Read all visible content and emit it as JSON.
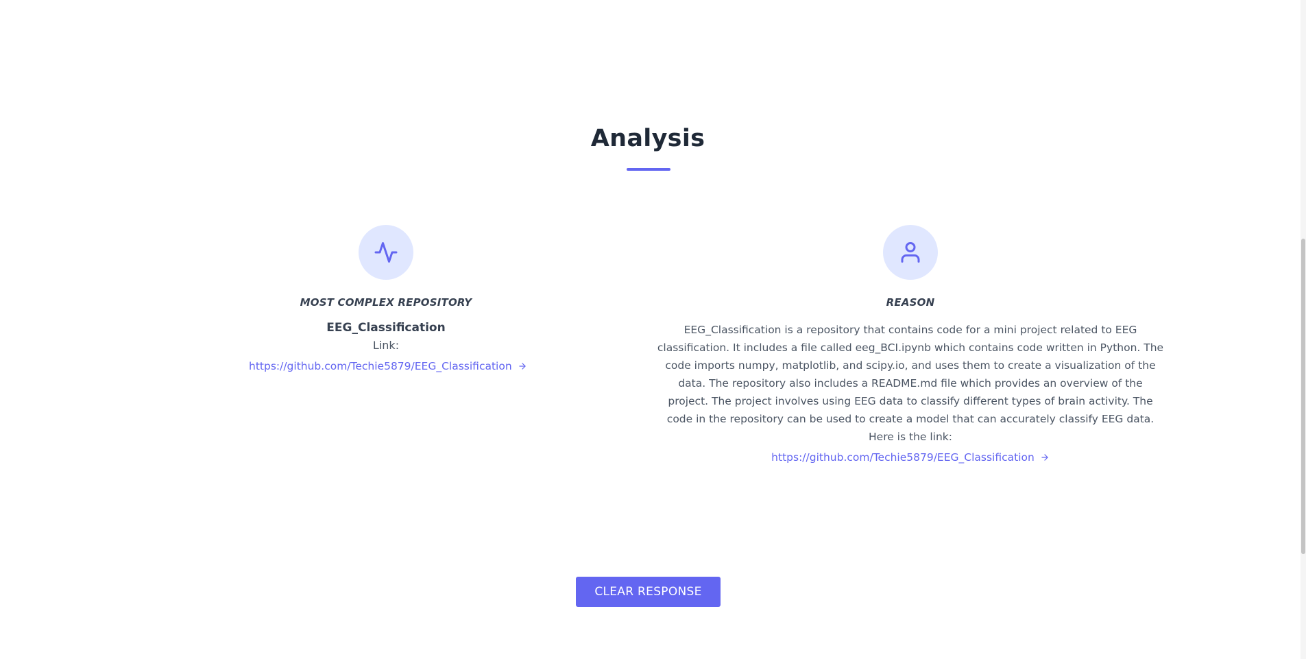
{
  "section": {
    "title": "Analysis"
  },
  "left": {
    "label": "MOST COMPLEX REPOSITORY",
    "repo_name": "EEG_Classification",
    "link_label": "Link:",
    "link_text": "https://github.com/Techie5879/EEG_Classification",
    "icon": "activity-icon"
  },
  "right": {
    "label": "REASON",
    "text": "EEG_Classification is a repository that contains code for a mini project related to EEG classification. It includes a file called eeg_BCI.ipynb which contains code written in Python. The code imports numpy, matplotlib, and scipy.io, and uses them to create a visualization of the data. The repository also includes a README.md file which provides an overview of the project. The project involves using EEG data to classify different types of brain activity. The code in the repository can be used to create a model that can accurately classify EEG data.",
    "link_label": "Here is the link:",
    "link_text": "https://github.com/Techie5879/EEG_Classification",
    "icon": "user-icon"
  },
  "actions": {
    "clear_label": "CLEAR RESPONSE"
  },
  "colors": {
    "accent": "#6366f1",
    "icon_bg": "#e0e7ff",
    "heading": "#1f2937",
    "body": "#4b5563"
  }
}
